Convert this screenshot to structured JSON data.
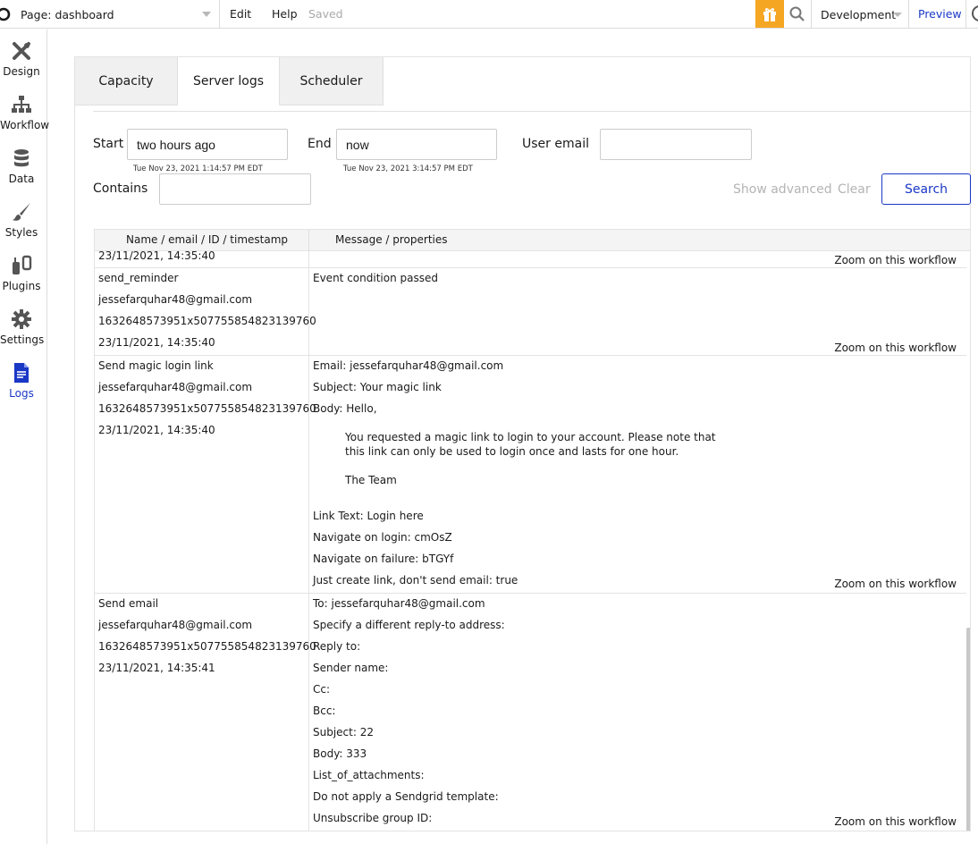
{
  "topbar": {
    "page_label": "Page: dashboard",
    "menu_edit": "Edit",
    "menu_help": "Help",
    "saved": "Saved",
    "environment": "Development",
    "preview": "Preview"
  },
  "sidebar": {
    "items": [
      {
        "label": "Design",
        "icon": "design-icon"
      },
      {
        "label": "Workflow",
        "icon": "workflow-icon"
      },
      {
        "label": "Data",
        "icon": "database-icon"
      },
      {
        "label": "Styles",
        "icon": "brush-icon"
      },
      {
        "label": "Plugins",
        "icon": "plug-icon"
      },
      {
        "label": "Settings",
        "icon": "gear-icon"
      },
      {
        "label": "Logs",
        "icon": "document-icon"
      }
    ],
    "active": "Logs"
  },
  "tabs": [
    "Capacity",
    "Server logs",
    "Scheduler"
  ],
  "filters": {
    "start_label": "Start",
    "start_value": "two hours ago",
    "start_sub": "Tue Nov 23, 2021 1:14:57 PM EDT",
    "end_label": "End",
    "end_value": "now",
    "end_sub": "Tue Nov 23, 2021 3:14:57 PM EDT",
    "user_email_label": "User email",
    "user_email_value": "",
    "contains_label": "Contains",
    "contains_value": "",
    "show_advanced": "Show advanced",
    "clear": "Clear",
    "search": "Search"
  },
  "table": {
    "col1": "Name / email / ID / timestamp",
    "col2": "Message / properties",
    "zoom_label": "Zoom on this workflow",
    "rows": [
      {
        "left": [
          "23/11/2021, 14:35:40"
        ]
      },
      {
        "left": [
          "send_reminder",
          "jessefarquhar48@gmail.com",
          "1632648573951x507755854823139760",
          "23/11/2021, 14:35:40"
        ],
        "message": "Event condition passed"
      },
      {
        "left": [
          "Send magic login link",
          "jessefarquhar48@gmail.com",
          "1632648573951x507755854823139760",
          "23/11/2021, 14:35:40"
        ],
        "email_line": "Email:  jessefarquhar48@gmail.com",
        "subject_line": "Subject:  Your magic link",
        "body_line": "Body:  Hello,",
        "body_p1": "You requested a magic link to login to your account. Please note that",
        "body_p2": "this link can only be used to login once and lasts for one hour.",
        "body_sign": "The Team",
        "link_text": "Link Text:  Login here",
        "nav_login": "Navigate on login:  cmOsZ",
        "nav_failure": "Navigate on failure:  bTGYf",
        "just_create": "Just create link, don't send email:  true"
      },
      {
        "left": [
          "Send email",
          "jessefarquhar48@gmail.com",
          "1632648573951x507755854823139760",
          "23/11/2021, 14:35:41"
        ],
        "props": [
          "To:  jessefarquhar48@gmail.com",
          "Specify a different reply-to address:",
          "Reply to:",
          "Sender name:",
          "Cc:",
          "Bcc:",
          "Subject:  22",
          "Body:  333",
          "List_of_attachments:",
          "Do not apply a Sendgrid template:",
          "Unsubscribe group ID:"
        ]
      }
    ]
  },
  "colors": {
    "accent": "#1a37c6",
    "gift": "#f5a623"
  }
}
